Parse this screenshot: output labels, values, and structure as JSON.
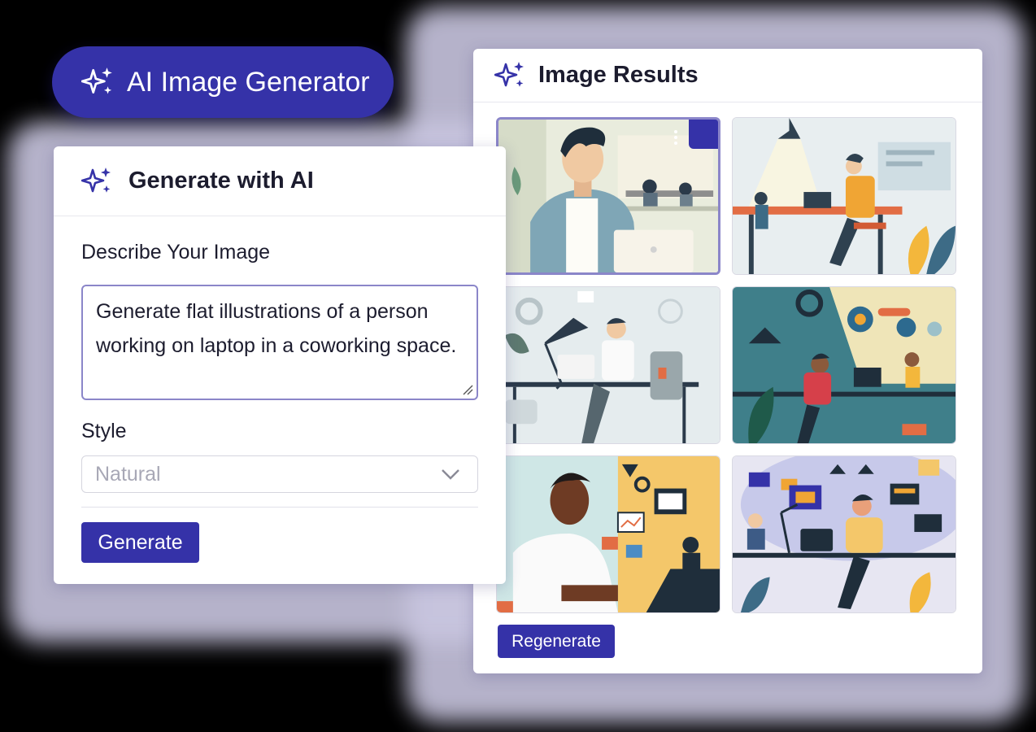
{
  "badge": {
    "title": "AI Image Generator",
    "icon": "sparkle-icon"
  },
  "results": {
    "title": "Image Results",
    "icon": "sparkle-icon",
    "images": [
      {
        "name": "illustration-man-laptop-coworking",
        "selected": true
      },
      {
        "name": "illustration-orange-office-desks",
        "selected": false
      },
      {
        "name": "illustration-desk-lamp-gears",
        "selected": false
      },
      {
        "name": "illustration-teal-workspace-gears",
        "selected": false
      },
      {
        "name": "illustration-man-white-shirt-icons",
        "selected": false
      },
      {
        "name": "illustration-purple-office-laptops",
        "selected": false
      }
    ],
    "regenerate_label": "Regenerate"
  },
  "generator": {
    "title": "Generate with AI",
    "icon": "sparkle-icon",
    "describe_label": "Describe Your Image",
    "prompt_value": "Generate flat illustrations of a person working on laptop in a coworking space.",
    "style_label": "Style",
    "style_value": "Natural",
    "generate_label": "Generate"
  },
  "colors": {
    "accent": "#3532a8",
    "selected_border": "#8b86c9",
    "text": "#1c1c2e",
    "muted": "#a8a8b6"
  }
}
